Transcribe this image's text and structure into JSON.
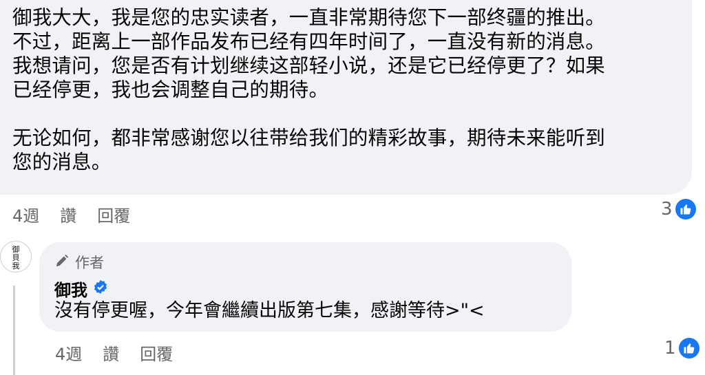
{
  "comment": {
    "lines": [
      "御我大大，我是您的忠实读者，一直非常期待您下一部终疆的推出。",
      "不过，距离上一部作品发布已经有四年时间了，一直没有新的消息。",
      "我想请问，您是否有计划继续这部轻小说，还是它已经停更了？如果",
      "已经停更，我也会调整自己的期待。",
      "无论如何，都非常感谢您以往带给我们的精彩故事，期待未来能听到",
      "您的消息。"
    ],
    "time": "4週",
    "like_label": "讚",
    "reply_label": "回覆",
    "reaction_count": "3"
  },
  "reply": {
    "author_tag": "作者",
    "author_name": "御我",
    "text": "沒有停更喔，今年會繼續出版第七集，感謝等待>\"<",
    "time": "4週",
    "like_label": "讚",
    "reply_label": "回覆",
    "reaction_count": "1",
    "avatar_text": "御貝我"
  },
  "colors": {
    "bubble": "#f0f2f5",
    "meta": "#65676b",
    "like_blue": "#1877f2",
    "verified_blue": "#1877f2"
  },
  "icons": [
    "like-icon",
    "pencil-icon",
    "verified-icon"
  ]
}
